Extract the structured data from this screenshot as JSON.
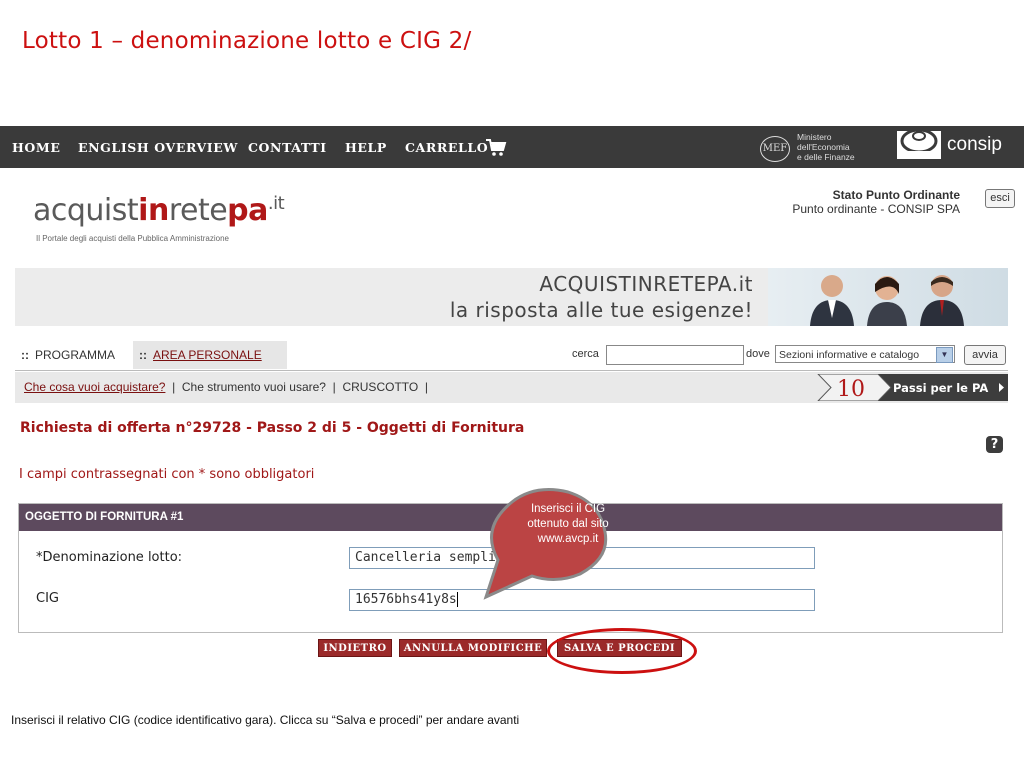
{
  "slide": {
    "title": "Lotto 1 – denominazione lotto e CIG 2/",
    "footnote": "Inserisci il relativo CIG (codice identificativo gara). Clicca su “Salva e procedi” per andare avanti"
  },
  "topnav": {
    "items": [
      "HOME",
      "ENGLISH OVERVIEW",
      "CONTATTI",
      "HELP",
      "CARRELLO"
    ],
    "mef_badge": "MEF",
    "mef_lines": [
      "Ministero",
      "dell'Economia",
      "e delle Finanze"
    ],
    "consip": "consip"
  },
  "header": {
    "logo_parts": [
      "acquist",
      "in",
      "rete",
      "pa",
      ".it"
    ],
    "logo_tagline": "Il Portale degli acquisti della Pubblica Amministrazione",
    "stato_title": "Stato Punto Ordinante",
    "stato_value": "Punto ordinante - CONSIP SPA",
    "esci": "esci"
  },
  "banner": {
    "line1": "ACQUISTINRETEPA.it",
    "line2": "la risposta alle tue esigenze!"
  },
  "tabs": {
    "dots": "::",
    "programma": "PROGRAMMA",
    "area": "AREA PERSONALE"
  },
  "search": {
    "cerca_label": "cerca",
    "cerca_value": "",
    "dove_label": "dove",
    "dove_value": "Sezioni informative e catalogo",
    "avvia": "avvia"
  },
  "submenu": {
    "link1": "Che cosa vuoi acquistare?",
    "sep": "|",
    "item2": "Che strumento vuoi usare?",
    "item3": "CRUSCOTTO",
    "passi_num": "10",
    "passi_text": "Passi per le PA"
  },
  "content": {
    "heading": "Richiesta di offerta n°29728 - Passo 2 di 5 - Oggetti di Fornitura",
    "help": "?",
    "required_note": "I campi contrassegnati con * sono obbligatori",
    "section_title": "OGGETTO DI FORNITURA #1",
    "field1_label": "*Denominazione lotto:",
    "field1_value": "Cancelleria semplif",
    "field2_label": "CIG",
    "field2_value": "16576bhs41y8s"
  },
  "buttons": {
    "indietro": "INDIETRO",
    "annulla": "ANNULLA MODIFICHE",
    "salva": "SALVA E PROCEDI"
  },
  "callout": {
    "lines": [
      "Inserisci il CIG",
      "ottenuto dal sito",
      "www.avcp.it"
    ],
    "fill": "#bb4444"
  },
  "colors": {
    "accent_red": "#cc1010",
    "brand_maroon": "#9b2a2a",
    "section_header": "#5d4a5e",
    "nav_bg": "#3a3a3a"
  }
}
